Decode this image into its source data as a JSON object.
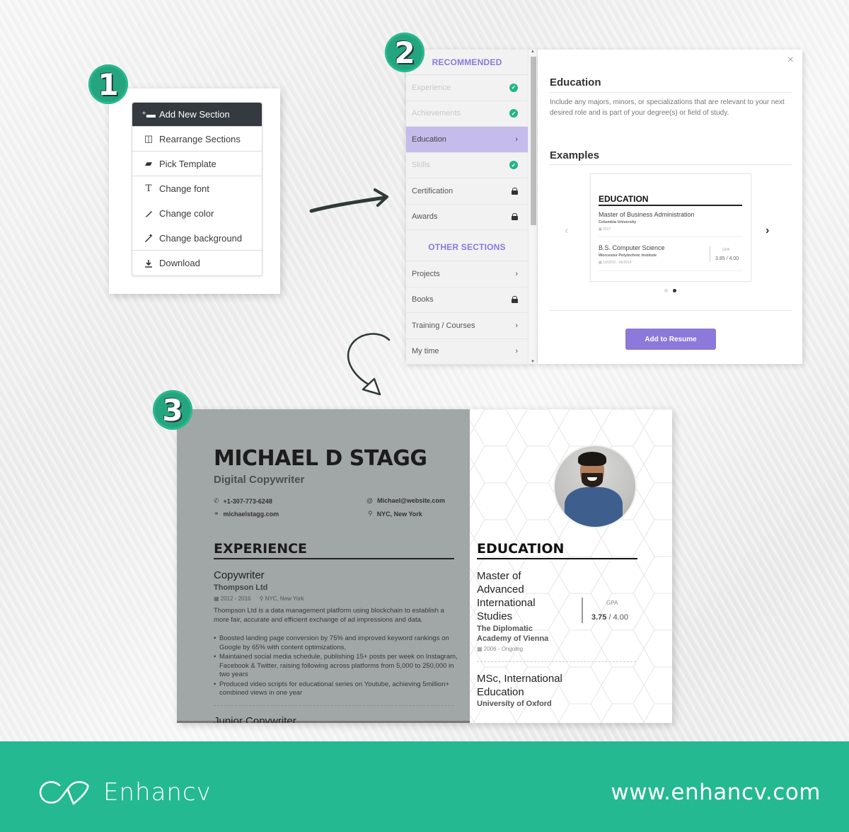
{
  "steps": [
    "1",
    "2",
    "3"
  ],
  "menu": {
    "items": [
      {
        "label": "Add New Section",
        "icon": "add-section-icon",
        "glyph": "⁺▬"
      },
      {
        "label": "Rearrange Sections",
        "icon": "layout-icon",
        "glyph": "◫"
      },
      {
        "label": "Pick Template",
        "icon": "template-icon",
        "glyph": "▰"
      },
      {
        "label": "Change font",
        "icon": "font-icon",
        "glyph": "T"
      },
      {
        "label": "Change color",
        "icon": "brush-icon",
        "glyph": "⁄"
      },
      {
        "label": "Change background",
        "icon": "magic-wand-icon",
        "glyph": "✐"
      },
      {
        "label": "Download",
        "icon": "download-icon",
        "glyph": "⤓"
      }
    ]
  },
  "sections_panel": {
    "recommended_header": "RECOMMENDED",
    "recommended": [
      {
        "label": "Experience",
        "state": "done"
      },
      {
        "label": "Achievements",
        "state": "done"
      },
      {
        "label": "Education",
        "state": "selected"
      },
      {
        "label": "Skills",
        "state": "done"
      },
      {
        "label": "Certification",
        "state": "locked"
      },
      {
        "label": "Awards",
        "state": "locked"
      }
    ],
    "other_header": "OTHER SECTIONS",
    "other": [
      {
        "label": "Projects",
        "state": "open"
      },
      {
        "label": "Books",
        "state": "locked"
      },
      {
        "label": "Training / Courses",
        "state": "open"
      },
      {
        "label": "My time",
        "state": "open"
      }
    ]
  },
  "detail": {
    "close": "×",
    "title": "Education",
    "description": "Include any majors, minors, or specializations that are relevant to your next desired role and is part of your degree(s) or field of study.",
    "examples_title": "Examples",
    "example": {
      "heading": "EDUCATION",
      "entries": [
        {
          "degree": "Master of Business Administration",
          "school": "Columbia University",
          "date": "2017"
        },
        {
          "degree": "B.S. Computer Science",
          "school": "Worcester Polytechnic Institute",
          "date": "10/2010 - 06/2014",
          "gpa_label": "GPA",
          "gpa": "3.85 / 4.00"
        }
      ]
    },
    "carousel": {
      "prev": "‹",
      "next": "›",
      "pages": 2,
      "current": 2
    },
    "add_button": "Add to Resume"
  },
  "resume": {
    "name": "MICHAEL D STAGG",
    "role": "Digital Copywriter",
    "phone": "+1-307-773-6248",
    "website": "michaelstagg.com",
    "email": "Michael@website.com",
    "location": "NYC, New York",
    "experience_heading": "EXPERIENCE",
    "job_title": "Copywriter",
    "company": "Thompson Ltd",
    "job_dates": "2012 - 2016",
    "job_location": "NYC, New York",
    "job_description": "Thompson Ltd is a data management platform using blockchain to establish a more fair, accurate and efficient exchange of ad impressions and data.",
    "bullets": [
      "Boosted landing page conversion by 75% and improved keyword rankings on Google by 65% with content optimizations,",
      "Maintained social media schedule, publishing 15+ posts per week on Instagram, Facebook & Twitter, raising following across platforms from 5,000 to 250,000 in two years",
      "Produced video scripts for educational series on Youtube, achieving 5million+ combined views in one year"
    ],
    "next_job": "Junior Copywriter",
    "education_heading": "EDUCATION",
    "education": [
      {
        "degree": "Master of Advanced International Studies",
        "school": "The Diplomatic Academy of Vienna",
        "date": "2006 - Ongoing",
        "gpa_label": "GPA",
        "gpa": "3.75",
        "gpa_max": "4.00"
      },
      {
        "degree": "MSc, International Education",
        "school": "University of Oxford"
      }
    ]
  },
  "footer": {
    "brand": "Enhancv",
    "url": "www.enhancv.com"
  },
  "colors": {
    "accent_green": "#24b991",
    "accent_purple": "#8c79d9",
    "dark_menu": "#343a40"
  }
}
